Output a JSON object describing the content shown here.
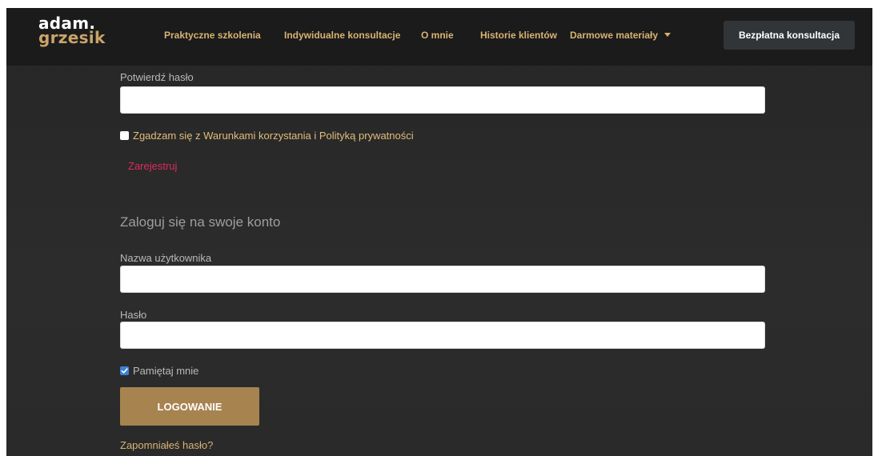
{
  "logo": {
    "line1": "adam.",
    "line2": "grzesik"
  },
  "nav": {
    "items": [
      {
        "label": "Praktyczne szkolenia"
      },
      {
        "label": "Indywidualne konsultacje"
      },
      {
        "label": "O mnie"
      },
      {
        "label": "Historie klientów"
      },
      {
        "label": "Darmowe materiały"
      }
    ],
    "cta_label": "Bezpłatna konsultacja"
  },
  "register": {
    "confirm_password_label": "Potwierdź hasło",
    "confirm_password_value": "",
    "terms_label": "Zgadzam się z Warunkami korzystania i Polityką prywatności",
    "terms_checked": false,
    "submit_label": "Zarejestruj"
  },
  "login": {
    "title": "Zaloguj się na swoje konto",
    "username_label": "Nazwa użytkownika",
    "username_value": "",
    "password_label": "Hasło",
    "password_value": "",
    "remember_label": "Pamiętaj mnie",
    "remember_checked": true,
    "submit_label": "LOGOWANIE",
    "forgot_label": "Zapomniałeś hasło?"
  },
  "colors": {
    "accent_gold": "#d7b373",
    "button_gold": "#a7834f",
    "link_pink": "#e0295f",
    "checkbox_blue": "#3b82d6"
  }
}
